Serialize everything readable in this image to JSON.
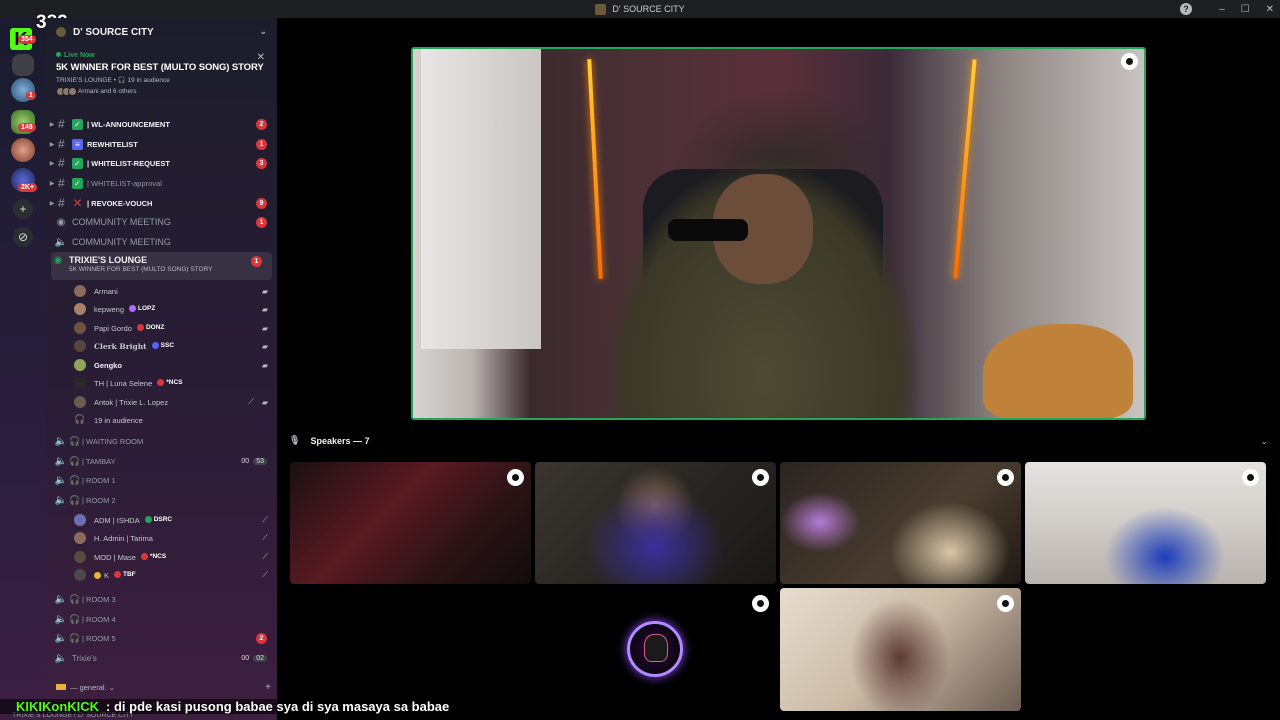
{
  "window": {
    "title": "D' SOURCE CITY",
    "help": "?",
    "minimize": "–",
    "maximize": "☐",
    "close": "✕"
  },
  "stream_overlay": {
    "viewer_count": "382",
    "kick_logo": "K"
  },
  "rail": {
    "badges": [
      "354",
      "1",
      "148",
      "2K+"
    ],
    "add_label": "+",
    "discover_label": "⊘"
  },
  "server": {
    "name": "D' SOURCE CITY",
    "chevron": "⌄"
  },
  "live_card": {
    "status": "Live Now",
    "title": "5K WINNER FOR BEST (MULTO SONG) STORY",
    "meta": "TRIXIE'S LOUNGE • 🎧 19 in audience",
    "others": "Armani and 6 others",
    "close": "✕"
  },
  "channels": [
    {
      "name": "| WL-ANNOUNCEMENT",
      "badge": "2",
      "box_color": "#23a55a",
      "box_glyph": "✓"
    },
    {
      "name": "REWHITELIST",
      "badge": "1",
      "box_color": "#5865f2",
      "box_glyph": "≡"
    },
    {
      "name": "| WHITELIST-REQUEST",
      "badge": "3",
      "box_color": "#23a55a",
      "box_glyph": "✓"
    },
    {
      "name": "| WHITELIST-approval",
      "badge": "",
      "box_color": "#23a55a",
      "box_glyph": "✓"
    },
    {
      "name": "| REVOKE-VOUCH",
      "badge": "9",
      "box_color": "#da373c",
      "box_glyph": "✕"
    }
  ],
  "voice_channels_top": [
    {
      "name": "COMMUNITY MEETING",
      "badge": "1",
      "icon": "stage"
    },
    {
      "name": "COMMUNITY MEETING",
      "badge": "",
      "icon": "speaker"
    }
  ],
  "active_channel": {
    "name": "TRIXIE'S LOUNGE",
    "subtitle": "5K WINNER FOR BEST (MULTO SONG) STORY",
    "badge": "1"
  },
  "lounge_users": [
    {
      "name": "Armani",
      "tag": "",
      "tag_color": ""
    },
    {
      "name": "kepweng",
      "tag": "LOPZ",
      "tag_color": "#b06bff"
    },
    {
      "name": "Papi Gordo",
      "tag": "DONZ",
      "tag_color": "#da373c"
    },
    {
      "name": "Clerk Bright",
      "tag": "SSC",
      "tag_color": "#5865f2"
    },
    {
      "name": "Gengko",
      "tag": "",
      "tag_color": ""
    },
    {
      "name": "TH | Luna Selene",
      "tag": "*NCS",
      "tag_color": "#da373c"
    },
    {
      "name": "Antok | Trixie L. Lopez",
      "tag": "",
      "tag_color": ""
    },
    {
      "name": "19 in audience",
      "tag": "",
      "tag_color": ""
    }
  ],
  "rooms": [
    {
      "name": "| WAITING ROOM",
      "count_a": "",
      "count_b": "",
      "badge": ""
    },
    {
      "name": "| TAMBAY",
      "count_a": "00",
      "count_b": "53",
      "badge": ""
    },
    {
      "name": "| ROOM 1",
      "count_a": "",
      "count_b": "",
      "badge": ""
    },
    {
      "name": "| ROOM 2",
      "count_a": "",
      "count_b": "",
      "badge": ""
    }
  ],
  "room2_users": [
    {
      "name": "ADM | ISHDA",
      "tag": "DSRC",
      "tag_color": "#23a55a"
    },
    {
      "name": "H. Admin | Tarima",
      "tag": "",
      "tag_color": ""
    },
    {
      "name": "MOD | Mase",
      "tag": "*NCS",
      "tag_color": "#da373c"
    },
    {
      "name": "K",
      "tag": "TBF",
      "tag_color": "#da373c"
    }
  ],
  "rooms_bottom": [
    {
      "name": "| ROOM 3",
      "count_a": "",
      "count_b": "",
      "badge": ""
    },
    {
      "name": "| ROOM 4",
      "count_a": "",
      "count_b": "",
      "badge": ""
    },
    {
      "name": "| ROOM 5",
      "count_a": "",
      "count_b": "",
      "badge": "2"
    },
    {
      "name": "Trixie's",
      "count_a": "00",
      "count_b": "02",
      "badge": ""
    }
  ],
  "general": {
    "label": "— general. ⌄",
    "plus": "+"
  },
  "stage": {
    "speakers_label": "Speakers — 7",
    "mic_icon": "🎙",
    "chevron": "⌄"
  },
  "chat_overlay": {
    "user": "KIKIKonKICK",
    "message": ": di pde kasi pusong babae sya di sya masaya sa babae"
  },
  "bottom_status": "TRIXIE'S LOUNGE / D' SOURCE CITY"
}
